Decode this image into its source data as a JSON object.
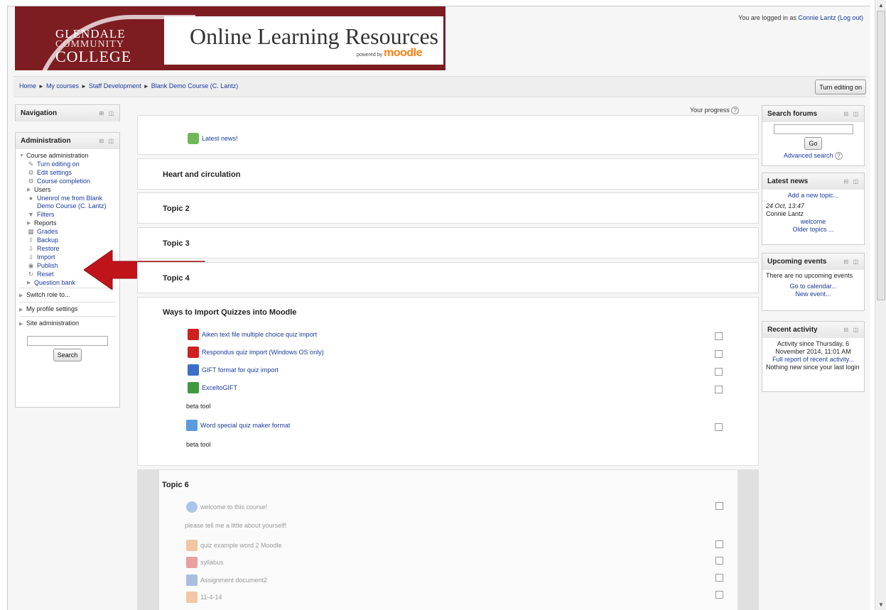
{
  "header": {
    "college_line1": "GLENDALE",
    "college_line2": "COMMUNITY",
    "college_line3": "COLLEGE",
    "site_title": "Online Learning Resources",
    "powered_by": "powered by",
    "moodle": "moodle",
    "login_prefix": "You are logged in as",
    "user_name": "Connie Lantz",
    "logout": "(Log out)"
  },
  "breadcrumb": [
    "Home",
    "My courses",
    "Staff Development",
    "Blank Demo Course (C. Lantz)"
  ],
  "breadcrumb_sep": "►",
  "turn_editing_button": "Turn editing on",
  "navigation_block": {
    "title": "Navigation"
  },
  "administration": {
    "title": "Administration",
    "course_admin": "Course administration",
    "items": [
      {
        "label": "Turn editing on",
        "icon": "pencil-icon"
      },
      {
        "label": "Edit settings",
        "icon": "gear-icon"
      },
      {
        "label": "Course completion",
        "icon": "gear-icon"
      },
      {
        "label": "Users",
        "icon": "expand-triangle"
      },
      {
        "label": "Unenrol me from Blank Demo Course (C. Lantz)",
        "icon": "user-icon"
      },
      {
        "label": "Filters",
        "icon": "filter-icon"
      },
      {
        "label": "Reports",
        "icon": "expand-triangle"
      },
      {
        "label": "Grades",
        "icon": "grades-icon"
      },
      {
        "label": "Backup",
        "icon": "backup-icon"
      },
      {
        "label": "Restore",
        "icon": "restore-icon"
      },
      {
        "label": "Import",
        "icon": "import-icon"
      },
      {
        "label": "Publish",
        "icon": "publish-icon"
      },
      {
        "label": "Reset",
        "icon": "reset-icon"
      },
      {
        "label": "Question bank",
        "icon": "expand-triangle"
      }
    ],
    "switch_role": "Switch role to...",
    "my_profile": "My profile settings",
    "site_admin": "Site administration",
    "search_button": "Search"
  },
  "progress_label": "Your progress",
  "sections": {
    "latest_news": "Latest news!",
    "s1": "Heart and circulation",
    "s2": "Topic 2",
    "s3": "Topic 3",
    "s4": "Topic 4",
    "s5": "Ways to Import Quizzes into Moodle",
    "s5_items": [
      "Aiken text file multiple choice quiz import",
      "Respondus quiz import (Windows OS only)",
      "GIFT format for quiz import",
      "ExceltoGIFT"
    ],
    "beta1": "beta tool",
    "word_item": "Word special quiz maker format",
    "beta2": "beta tool",
    "s6": "Topic 6",
    "s6_items": [
      "welcome to this course!",
      "quiz example word 2 Moodle",
      "syllabus",
      "Assignment document2",
      "11-4-14"
    ],
    "s6_note": "please tell me a little about yourself!"
  },
  "search_forums": {
    "title": "Search forums",
    "go": "Go",
    "advanced": "Advanced search"
  },
  "latest_news": {
    "title": "Latest news",
    "add": "Add a new topic...",
    "date": "24 Oct, 13:47",
    "author": "Connie Lantz",
    "post": "welcome",
    "older": "Older topics ..."
  },
  "upcoming": {
    "title": "Upcoming events",
    "none": "There are no upcoming events",
    "calendar": "Go to calendar...",
    "new_event": "New event..."
  },
  "recent": {
    "title": "Recent activity",
    "since": "Activity since Thursday, 6 November 2014, 11:01 AM",
    "full": "Full report of recent activity...",
    "nothing": "Nothing new since your last login"
  },
  "colors": {
    "banner": "#7d1d22",
    "arrow": "#c0141a",
    "link": "#1a3a9c"
  }
}
